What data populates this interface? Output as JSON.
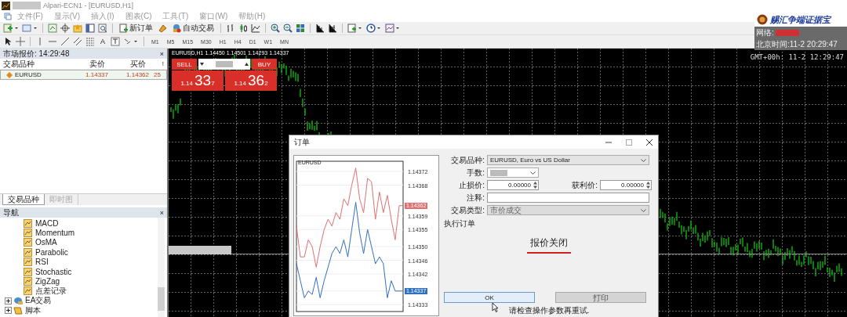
{
  "window": {
    "title": "Alpari-ECN1 - [EURUSD,H1]"
  },
  "menu": [
    "文件(F)",
    "显示(V)",
    "插入(I)",
    "图表(C)",
    "工具(T)",
    "窗口(W)",
    "帮助(H)"
  ],
  "toolbar": {
    "new_order": "新订单",
    "auto_trading": "自动交易"
  },
  "drawing_tools": {
    "text_tool": "A"
  },
  "timeframes": [
    "M1",
    "M5",
    "M15",
    "M30",
    "H1",
    "H4",
    "D1",
    "W1",
    "MN"
  ],
  "info_box": {
    "logo": "赐汇争端证据宝",
    "network_label": "网络:",
    "beijing_time": "北京时间:11-2 20:29:47",
    "gmt_time": "GMT+00h: 11-2 12:29:47"
  },
  "market_watch": {
    "title": "市场报价: 14:29:48",
    "close": "×",
    "columns": [
      "交易品种",
      "卖价",
      "买价",
      "!"
    ],
    "rows": [
      {
        "symbol": "EURUSD",
        "bid": "1.14337",
        "ask": "1.14362",
        "spread": "25"
      }
    ],
    "tabs": [
      {
        "label": "交易品种",
        "selected": true
      },
      {
        "label": "即时图",
        "selected": false
      }
    ]
  },
  "navigator": {
    "title": "导航",
    "close": "×",
    "items": [
      {
        "label": "MACD",
        "kind": "indicator"
      },
      {
        "label": "Momentum",
        "kind": "indicator"
      },
      {
        "label": "OsMA",
        "kind": "indicator"
      },
      {
        "label": "Parabolic",
        "kind": "indicator"
      },
      {
        "label": "RSI",
        "kind": "indicator"
      },
      {
        "label": "Stochastic",
        "kind": "indicator"
      },
      {
        "label": "ZigZag",
        "kind": "indicator"
      },
      {
        "label": "点差记录",
        "kind": "indicator"
      },
      {
        "label": "EA交易",
        "kind": "experts",
        "expanded": false
      },
      {
        "label": "脚本",
        "kind": "scripts",
        "expanded": false
      }
    ]
  },
  "chart": {
    "header": "EURUSD,H1  1.14450 1.14501 1.14293 1.14337",
    "one_click": {
      "sell": "SELL",
      "buy": "BUY",
      "sell_price": {
        "big": "1.14",
        "main": "33",
        "pip": "7"
      },
      "buy_price": {
        "big": "1.14",
        "main": "36",
        "pip": "2"
      }
    }
  },
  "dialog": {
    "title": "订单",
    "chart_symbol": "EURUSD",
    "ask_tag": "1.14362",
    "bid_tag": "1.14337",
    "chart_data": {
      "type": "line",
      "grid": true,
      "ylim": [
        1.14331,
        1.14375
      ],
      "yticks": [
        1.14333,
        1.14337,
        1.14342,
        1.14346,
        {
          "value": 1.1435,
          "label": "1.14350"
        },
        1.14355,
        1.14359,
        1.14368,
        1.14372
      ],
      "series": [
        {
          "color": "#e07070",
          "values": [
            1.14356,
            1.14347,
            1.14347,
            1.14352,
            1.1435,
            1.14344,
            1.1435,
            1.14355,
            1.14358,
            1.14356,
            1.1436,
            1.14358,
            1.14364,
            1.14362,
            1.14368,
            1.14373,
            1.14364,
            1.1436,
            1.1437,
            1.14369,
            1.14358,
            1.14366,
            1.1436,
            1.14365,
            1.14358,
            1.14352,
            1.14362,
            1.14362
          ]
        },
        {
          "color": "#3070c0",
          "values": [
            1.14345,
            1.1434,
            1.14335,
            1.14337,
            1.14336,
            1.14341,
            1.14335,
            1.1434,
            1.14344,
            1.14348,
            1.1435,
            1.14348,
            1.14352,
            1.14347,
            1.14355,
            1.14363,
            1.14354,
            1.14348,
            1.14355,
            1.1435,
            1.14345,
            1.14347,
            1.14345,
            1.14335,
            1.1434,
            1.14337,
            1.14337,
            1.14337
          ]
        }
      ]
    },
    "symbol": {
      "label": "交易品种:",
      "value": "EURUSD, Euro vs US Dollar"
    },
    "volume": {
      "label": "手数:"
    },
    "stop_loss": {
      "label": "止损价:",
      "value": "0.00000"
    },
    "take_profit": {
      "label": "获利价:",
      "value": "0.00000"
    },
    "comment": {
      "label": "注释:"
    },
    "order_type": {
      "label": "交易类型:",
      "value": "市价成交",
      "disabled": true
    },
    "section": "执行订单",
    "status": "报价关闭",
    "buttons": [
      {
        "label": "OK",
        "disabled": false,
        "selected": true
      },
      {
        "label": "打印",
        "disabled": true,
        "selected": false
      }
    ],
    "message": "请检查操作参数再重试."
  }
}
